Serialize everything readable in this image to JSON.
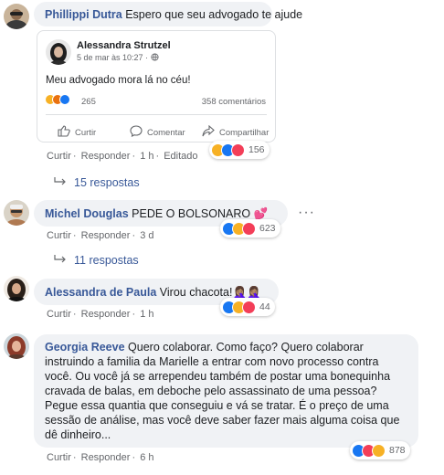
{
  "comments": [
    {
      "author": "Phillippi Dutra",
      "text": "Espero que seu advogado te ajude",
      "actions": {
        "like": "Curtir",
        "reply": "Responder",
        "time": "1 h",
        "edited": "Editado"
      },
      "reaction_count": "156",
      "reactions": [
        "haha-icon",
        "like-icon",
        "love-icon"
      ],
      "replies": "15 respostas",
      "shared_post": {
        "author": "Alessandra Strutzel",
        "date": "5 de mar às 10:27 · ",
        "privacy_icon": "globe-icon",
        "text": "Meu advogado mora lá no céu!",
        "reaction_count": "265",
        "reactions": [
          "haha-icon",
          "angry-icon",
          "like-icon"
        ],
        "comments": "358 comentários",
        "buttons": {
          "like": "Curtir",
          "comment": "Comentar",
          "share": "Compartilhar"
        }
      }
    },
    {
      "author": "Michel Douglas",
      "text": "PEDE O BOLSONARO 💕",
      "actions": {
        "like": "Curtir",
        "reply": "Responder",
        "time": "3 d"
      },
      "reaction_count": "623",
      "reactions": [
        "like-icon",
        "haha-icon",
        "love-icon"
      ],
      "replies": "11 respostas"
    },
    {
      "author": "Alessandra de Paula",
      "text": "Virou chacota!🤦🏽‍♀️🤦🏽‍♀️",
      "actions": {
        "like": "Curtir",
        "reply": "Responder",
        "time": "1 h"
      },
      "reaction_count": "44",
      "reactions": [
        "like-icon",
        "haha-icon",
        "love-icon"
      ]
    },
    {
      "author": "Georgia Reeve",
      "text": "Quero colaborar. Como faço? Quero colaborar instruindo a familia da Marielle a entrar com novo processo contra você. Ou você já se arrependeu também de postar uma bonequinha cravada de balas, em deboche pelo assassinato de uma pessoa? Pegue essa quantia que conseguiu e vá se tratar. É o preço de uma sessão de análise, mas você deve saber fazer mais alguma coisa que dê dinheiro...",
      "actions": {
        "like": "Curtir",
        "reply": "Responder",
        "time": "6 h"
      },
      "reaction_count": "878",
      "reactions": [
        "like-icon",
        "love-icon",
        "haha-icon"
      ]
    }
  ],
  "colors": {
    "link": "#385898",
    "meta": "#65676b",
    "bubble": "#f0f2f5",
    "like": "#1877f2",
    "love": "#f33e58",
    "haha": "#f7b125"
  }
}
